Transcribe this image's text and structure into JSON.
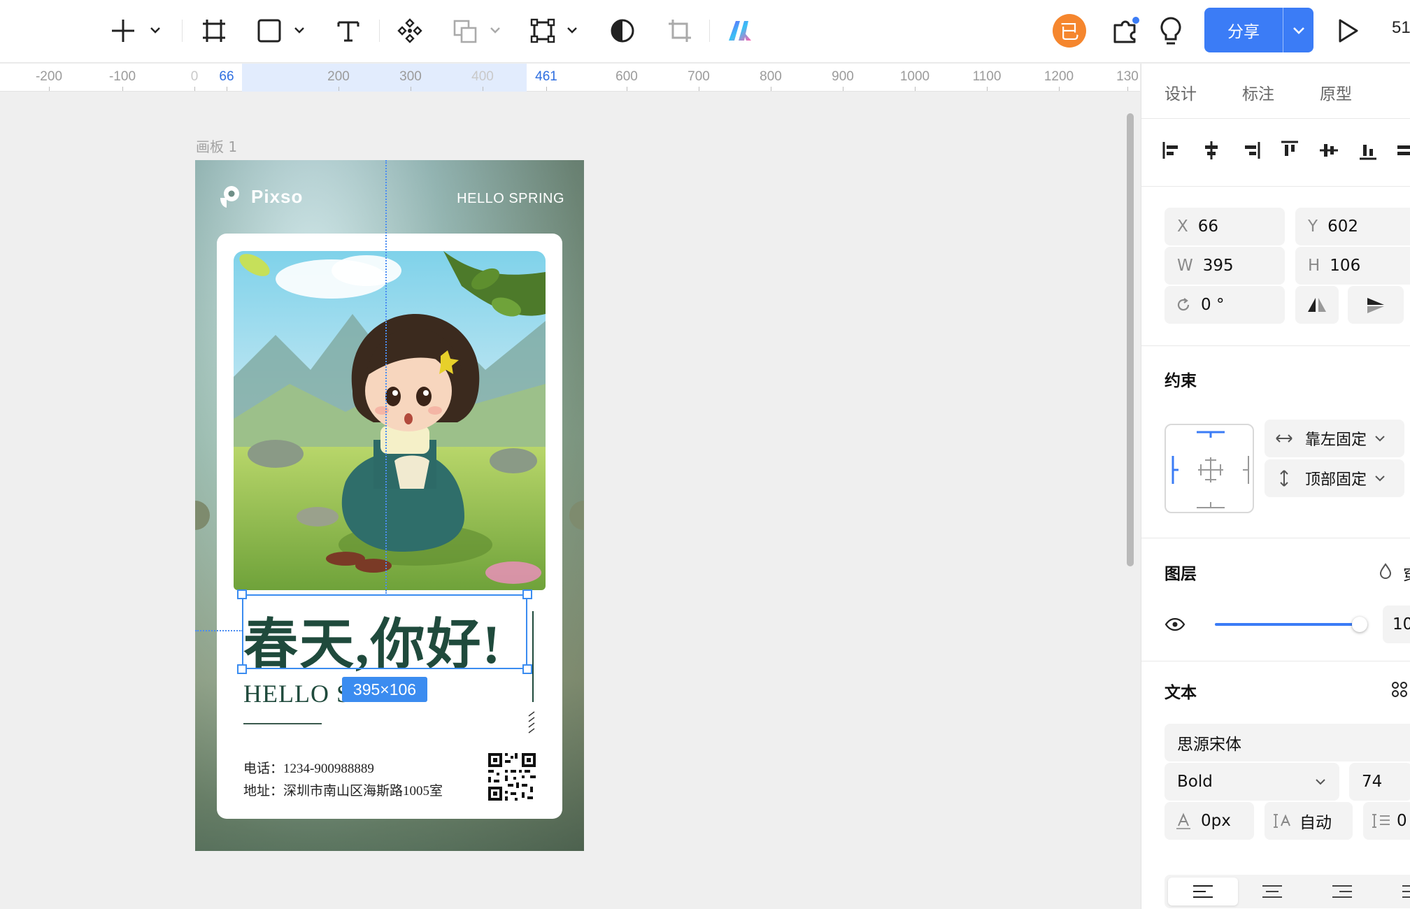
{
  "toolbar": {
    "icons": [
      "plus-icon",
      "frame-icon",
      "rectangle-icon",
      "text-icon",
      "component-icon",
      "boolean-icon",
      "vector-icon",
      "mask-icon",
      "crop-icon",
      "ai-icon"
    ],
    "avatar_initial": "已",
    "share_label": "分享",
    "zoom": "51"
  },
  "ruler": {
    "ticks": [
      {
        "label": "-200",
        "state": "normal"
      },
      {
        "label": "-100",
        "state": "normal"
      },
      {
        "label": "0",
        "state": "faint"
      },
      {
        "label": "66",
        "state": "selected"
      },
      {
        "label": "200",
        "state": "normal"
      },
      {
        "label": "300",
        "state": "normal"
      },
      {
        "label": "400",
        "state": "faint"
      },
      {
        "label": "461",
        "state": "selected"
      },
      {
        "label": "600",
        "state": "normal"
      },
      {
        "label": "700",
        "state": "normal"
      },
      {
        "label": "800",
        "state": "normal"
      },
      {
        "label": "900",
        "state": "normal"
      },
      {
        "label": "1000",
        "state": "normal"
      },
      {
        "label": "1100",
        "state": "normal"
      },
      {
        "label": "1200",
        "state": "normal"
      },
      {
        "label": "130",
        "state": "normal"
      }
    ]
  },
  "canvas": {
    "artboard_label": "画板 1",
    "poster": {
      "brand": "Pixso",
      "tagline": "HELLO SPRING",
      "headline": "春天,你好!",
      "subline": "HELLO S",
      "phone": "电话：1234-900988889",
      "address": "地址：深圳市南山区海斯路1005室"
    },
    "selection_size": "395×106"
  },
  "panel": {
    "tabs": [
      {
        "label": "设计",
        "active": true
      },
      {
        "label": "标注",
        "active": false
      },
      {
        "label": "原型",
        "active": false
      }
    ],
    "position": {
      "x_label": "X",
      "x": "66",
      "y_label": "Y",
      "y": "602",
      "w_label": "W",
      "w": "395",
      "h_label": "H",
      "h": "106",
      "rotation": "0 °"
    },
    "constraints": {
      "title": "约束",
      "horizontal": "靠左固定",
      "vertical": "顶部固定"
    },
    "layer": {
      "title": "图层",
      "blend_cut": "穿",
      "opacity_cut": "10",
      "opacity_fraction": 0.95
    },
    "text": {
      "title": "文本",
      "font_family": "思源宋体",
      "font_weight": "Bold",
      "font_size": "74",
      "letter_spacing": "0px",
      "line_height": "自动",
      "paragraph_cut": "0"
    }
  },
  "colors": {
    "accent": "#3b7cf6",
    "avatar": "#f5862e",
    "headline": "#1f4a3c"
  }
}
